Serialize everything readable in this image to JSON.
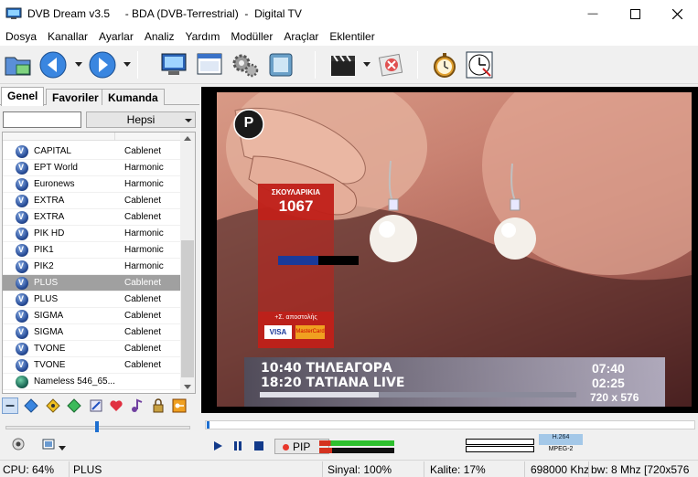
{
  "window": {
    "app_name": "DVB Dream v3.5",
    "mode": "BDA (DVB-Terrestrial)",
    "source": "Digital TV",
    "minimize_glyph": "—",
    "maximize_glyph": "☐",
    "close_glyph": "✕"
  },
  "menu": [
    "Dosya",
    "Kanallar",
    "Ayarlar",
    "Analiz",
    "Yardım",
    "Modüller",
    "Araçlar",
    "Eklentiler"
  ],
  "tabs": [
    "Genel",
    "Favoriler",
    "Kumanda"
  ],
  "filter": {
    "search_value": "",
    "combo_value": "Hepsi"
  },
  "channels": [
    {
      "name": "CAPITAL",
      "mux": "Cablenet",
      "icon": "v-icon"
    },
    {
      "name": "EPT World",
      "mux": "Harmonic",
      "icon": "v-icon"
    },
    {
      "name": "Euronews",
      "mux": "Harmonic",
      "icon": "v-icon"
    },
    {
      "name": "EXTRA",
      "mux": "Cablenet",
      "icon": "v-icon"
    },
    {
      "name": "EXTRA",
      "mux": "Cablenet",
      "icon": "v-icon"
    },
    {
      "name": "PIK HD",
      "mux": "Harmonic",
      "icon": "v-icon"
    },
    {
      "name": "PIK1",
      "mux": "Harmonic",
      "icon": "v-icon"
    },
    {
      "name": "PIK2",
      "mux": "Harmonic",
      "icon": "v-icon"
    },
    {
      "name": "PLUS",
      "mux": "Cablenet",
      "icon": "v-icon",
      "selected": true
    },
    {
      "name": "PLUS",
      "mux": "Cablenet",
      "icon": "v-icon"
    },
    {
      "name": "SIGMA",
      "mux": "Cablenet",
      "icon": "v-icon"
    },
    {
      "name": "SIGMA",
      "mux": "Cablenet",
      "icon": "v-icon"
    },
    {
      "name": "TVONE",
      "mux": "Cablenet",
      "icon": "v-icon"
    },
    {
      "name": "TVONE",
      "mux": "Cablenet",
      "icon": "v-icon"
    },
    {
      "name": "Nameless 546_65...",
      "mux": "",
      "icon": "globe-icon"
    }
  ],
  "video": {
    "channel_logo_letter": "P",
    "promo_heading": "ΣΚΟΥΛΑΡΙΚΙΑ",
    "promo_number": "1067",
    "promo_shipping": "+Σ. αποστολής",
    "card1": "VISA",
    "card2": "MasterCard",
    "epg": [
      {
        "time": "10:40",
        "title": "ΤΗΛΕΑΓΟΡΑ",
        "duration": "07:40"
      },
      {
        "time": "18:20",
        "title": "ΤΑΤΙΑΝΑ LIVE",
        "duration": "02:25"
      }
    ],
    "resolution": "720 x 576"
  },
  "controls": {
    "pip_label": "PIP",
    "codec_video": "H.264",
    "codec_audio": "MPEG-2"
  },
  "status": {
    "cpu": "CPU: 64%",
    "channel": "PLUS",
    "signal": "Sinyal: 100%",
    "quality": "Kalite: 17%",
    "frequency": "698000 Khz",
    "bandwidth": "bw: 8 Mhz [720x576"
  },
  "colors": {
    "accent": "#1e6fd0",
    "selected_row": "#a0a0a0",
    "promo_red": "#c0201a"
  }
}
